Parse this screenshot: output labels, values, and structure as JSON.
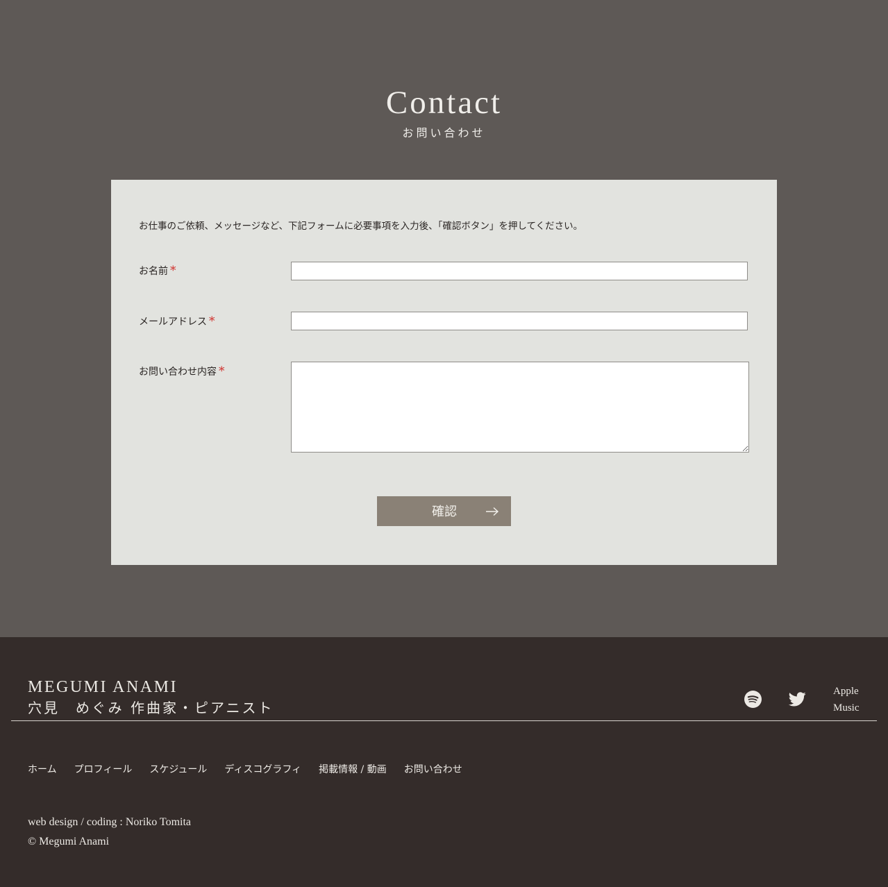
{
  "contact": {
    "title": "Contact",
    "subtitle": "お問い合わせ",
    "intro": "お仕事のご依頼、メッセージなど、下記フォームに必要事項を入力後、「確認ボタン」を押してください。",
    "required_mark": "*",
    "fields": [
      {
        "label": "お名前",
        "value": ""
      },
      {
        "label": "メールアドレス",
        "value": ""
      },
      {
        "label": "お問い合わせ内容",
        "value": ""
      }
    ],
    "confirm_label": "確認"
  },
  "footer": {
    "logo_en": "MEGUMI ANAMI",
    "logo_ja": "穴見　めぐみ 作曲家・ピアニスト",
    "social": {
      "spotify_icon": "spotify-icon",
      "twitter_icon": "twitter-icon",
      "apple_music_line1": "Apple",
      "apple_music_line2": "Music"
    },
    "nav": [
      {
        "label": "ホーム"
      },
      {
        "label": "プロフィール"
      },
      {
        "label": "スケジュール"
      },
      {
        "label": "ディスコグラフィ"
      },
      {
        "label": "掲載情報 / 動画"
      },
      {
        "label": "お問い合わせ"
      }
    ],
    "credit": "web design / coding : Noriko Tomita",
    "copyright": "© Megumi Anami"
  },
  "colors": {
    "page_background": "#5e5956",
    "form_background": "#e2e3df",
    "button_background": "#8a8176",
    "required_mark": "#d0302c",
    "footer_background": "#342c2a"
  }
}
